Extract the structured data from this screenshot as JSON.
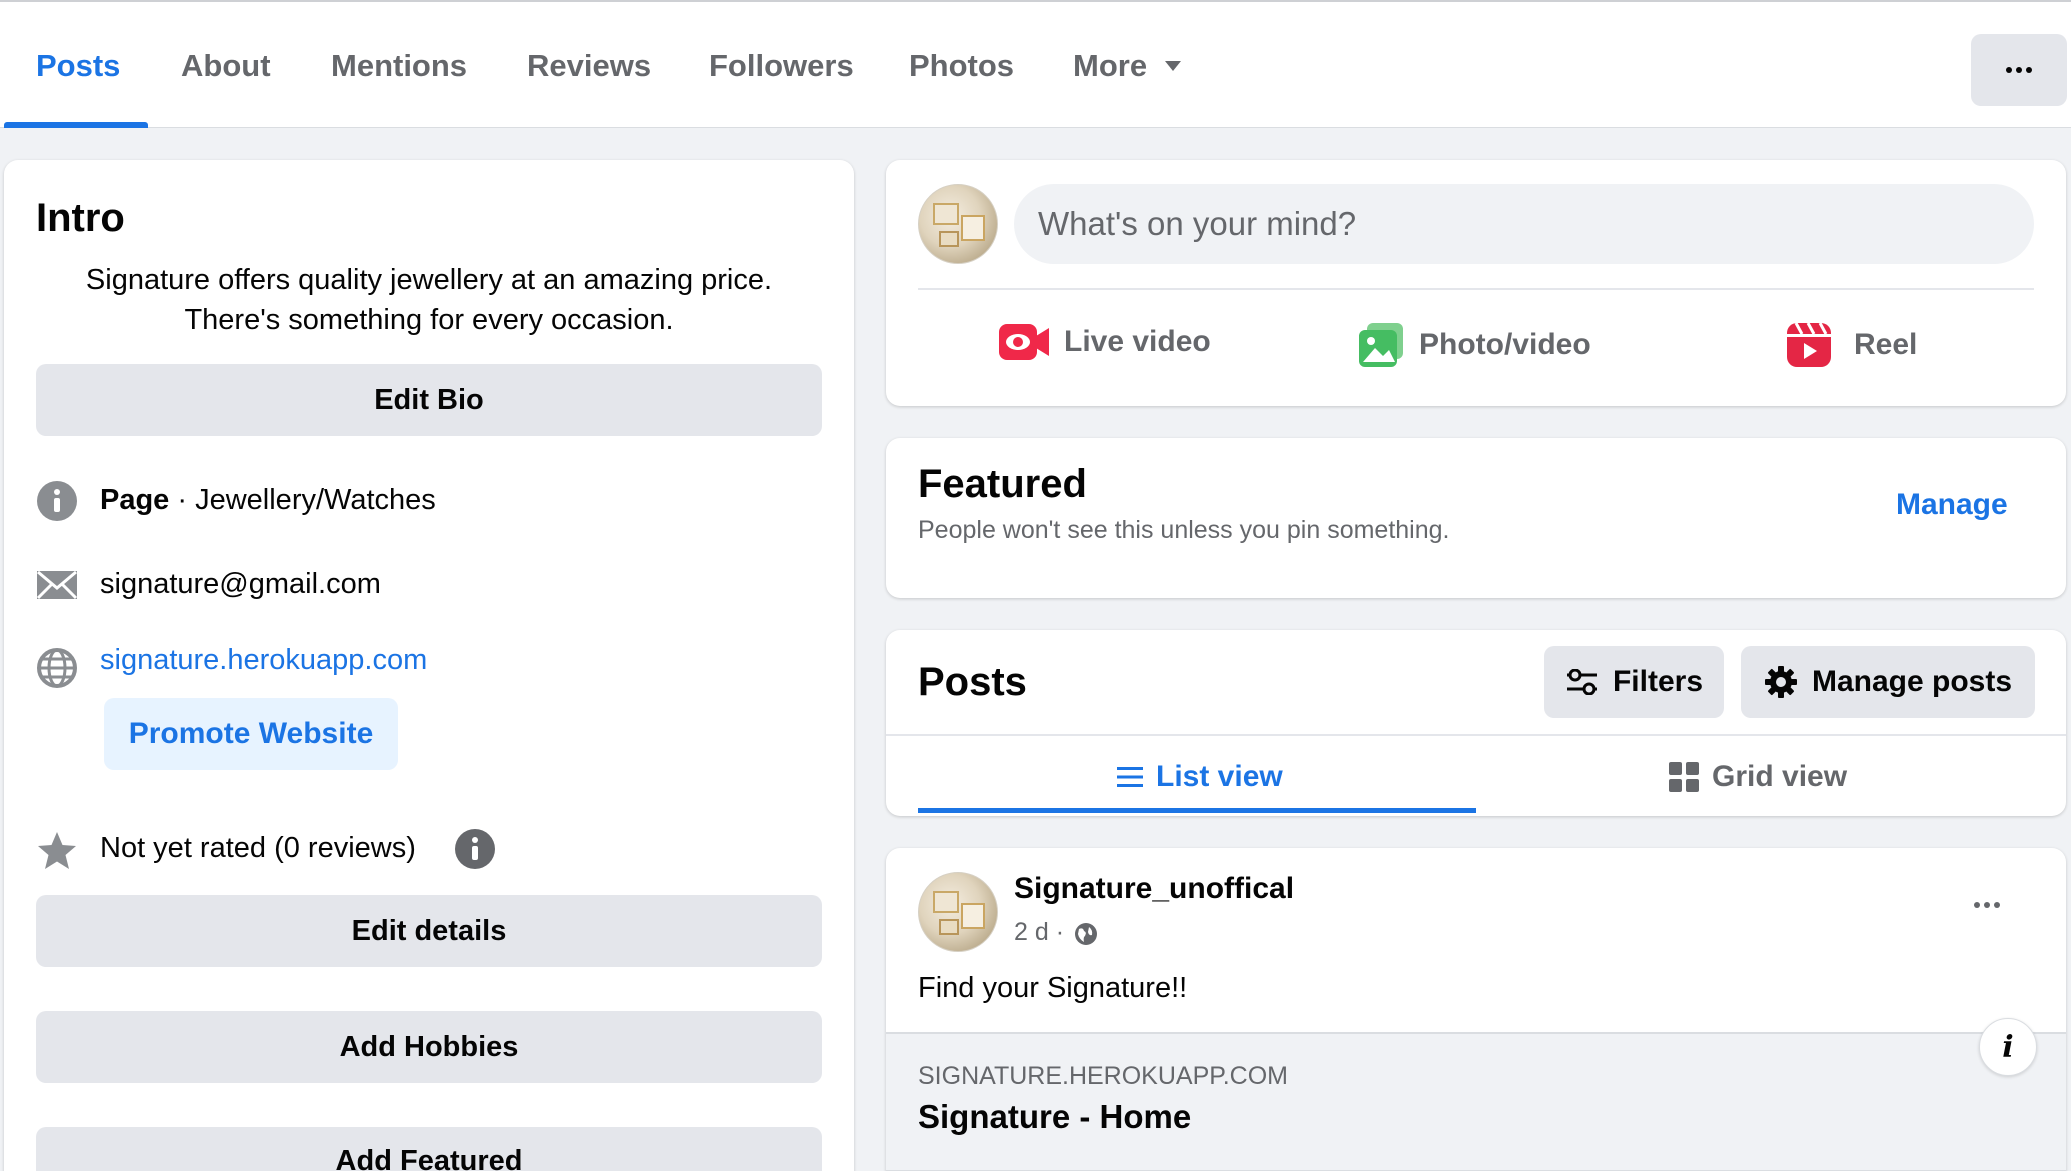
{
  "tabs": [
    {
      "label": "Posts",
      "active": true
    },
    {
      "label": "About"
    },
    {
      "label": "Mentions"
    },
    {
      "label": "Reviews"
    },
    {
      "label": "Followers"
    },
    {
      "label": "Photos"
    },
    {
      "label": "More"
    }
  ],
  "intro": {
    "title": "Intro",
    "bio_line1": "Signature offers quality jewellery at an amazing price.",
    "bio_line2": "There's something for every occasion.",
    "edit_bio": "Edit Bio",
    "page_label": "Page",
    "page_category": " · Jewellery/Watches",
    "email": "signature@gmail.com",
    "website": "signature.herokuapp.com",
    "promote_website": "Promote Website",
    "rating": "Not yet rated (0 reviews)",
    "edit_details": "Edit details",
    "add_hobbies": "Add Hobbies",
    "add_featured": "Add Featured"
  },
  "composer": {
    "placeholder": "What's on your mind?",
    "live_video": "Live video",
    "photo_video": "Photo/video",
    "reel": "Reel"
  },
  "featured": {
    "title": "Featured",
    "subtitle": "People won't see this unless you pin something.",
    "manage": "Manage"
  },
  "posts": {
    "title": "Posts",
    "filters": "Filters",
    "manage_posts": "Manage posts",
    "list_view": "List view",
    "grid_view": "Grid view"
  },
  "post": {
    "author": "Signature_unoffical",
    "time": "2 d ·",
    "text": "Find your Signature!!",
    "link_domain": "SIGNATURE.HEROKUAPP.COM",
    "link_title": "Signature - Home"
  },
  "colors": {
    "accent": "#1b74e4",
    "live_red": "#f02849",
    "photo_green": "#45bd62",
    "reel_pink": "#e42645"
  }
}
